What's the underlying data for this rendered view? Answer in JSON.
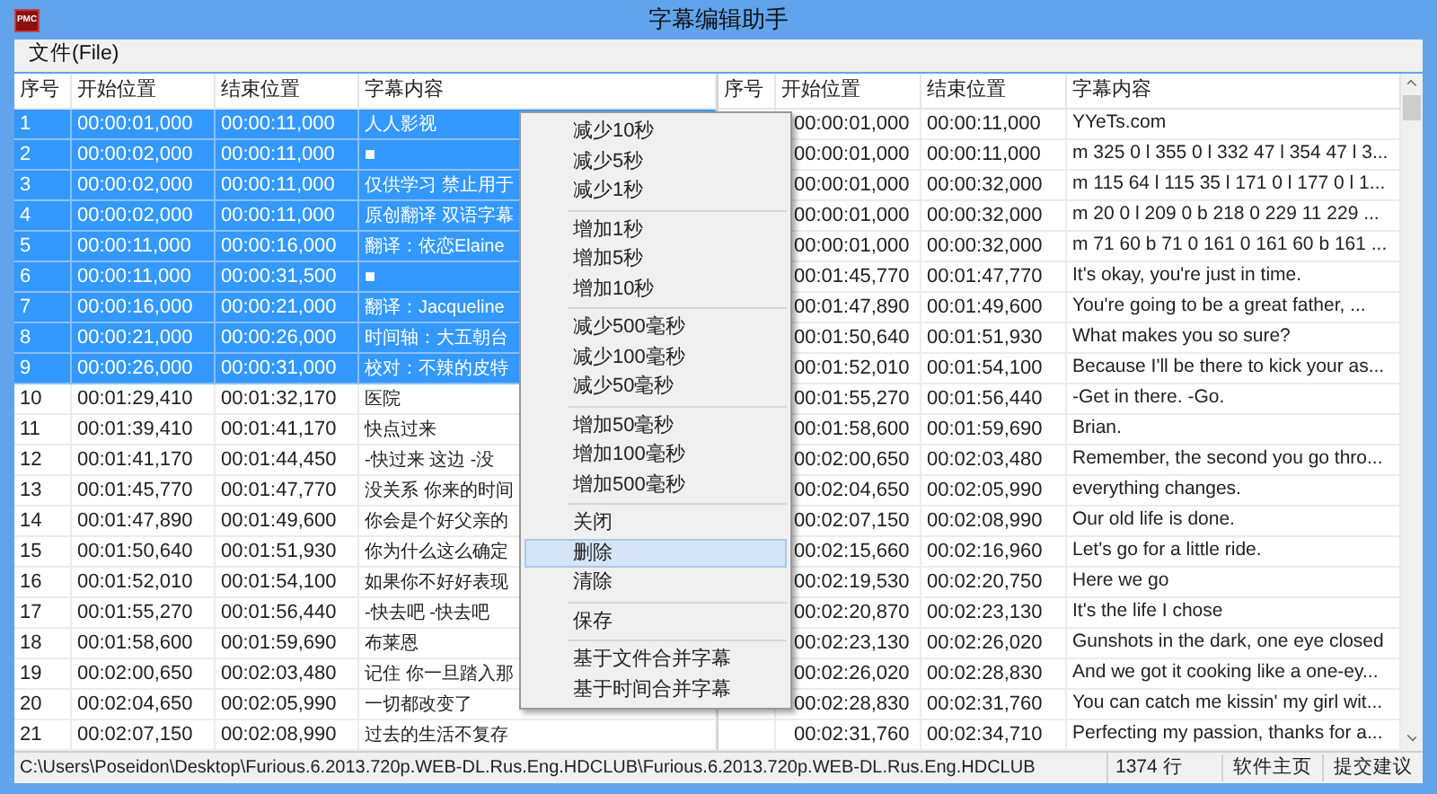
{
  "window": {
    "title": "字幕编辑助手",
    "icon_text": "PMC"
  },
  "menu_bar": [
    "文件(File)"
  ],
  "left_table": {
    "columns": [
      "序号",
      "开始位置",
      "结束位置",
      "字幕内容"
    ],
    "rows": [
      {
        "cells": [
          "1",
          "00:00:01,000",
          "00:00:11,000",
          "人人影视"
        ],
        "selected": true
      },
      {
        "cells": [
          "2",
          "00:00:02,000",
          "00:00:11,000",
          "■"
        ],
        "selected": true
      },
      {
        "cells": [
          "3",
          "00:00:02,000",
          "00:00:11,000",
          "仅供学习 禁止用于"
        ],
        "selected": true
      },
      {
        "cells": [
          "4",
          "00:00:02,000",
          "00:00:11,000",
          "原创翻译 双语字幕"
        ],
        "selected": true
      },
      {
        "cells": [
          "5",
          "00:00:11,000",
          "00:00:16,000",
          "翻译：依恋Elaine"
        ],
        "selected": true
      },
      {
        "cells": [
          "6",
          "00:00:11,000",
          "00:00:31,500",
          "■"
        ],
        "selected": true
      },
      {
        "cells": [
          "7",
          "00:00:16,000",
          "00:00:21,000",
          "翻译：Jacqueline"
        ],
        "selected": true
      },
      {
        "cells": [
          "8",
          "00:00:21,000",
          "00:00:26,000",
          "时间轴：大五朝台"
        ],
        "selected": true
      },
      {
        "cells": [
          "9",
          "00:00:26,000",
          "00:00:31,000",
          "校对：不辣的皮特"
        ],
        "selected": true
      },
      {
        "cells": [
          "10",
          "00:01:29,410",
          "00:01:32,170",
          "医院"
        ],
        "selected": false
      },
      {
        "cells": [
          "11",
          "00:01:39,410",
          "00:01:41,170",
          "快点过来"
        ],
        "selected": false
      },
      {
        "cells": [
          "12",
          "00:01:41,170",
          "00:01:44,450",
          "-快过来  这边  -没"
        ],
        "selected": false
      },
      {
        "cells": [
          "13",
          "00:01:45,770",
          "00:01:47,770",
          "没关系  你来的时间"
        ],
        "selected": false
      },
      {
        "cells": [
          "14",
          "00:01:47,890",
          "00:01:49,600",
          "你会是个好父亲的"
        ],
        "selected": false
      },
      {
        "cells": [
          "15",
          "00:01:50,640",
          "00:01:51,930",
          "你为什么这么确定"
        ],
        "selected": false
      },
      {
        "cells": [
          "16",
          "00:01:52,010",
          "00:01:54,100",
          "如果你不好好表现"
        ],
        "selected": false
      },
      {
        "cells": [
          "17",
          "00:01:55,270",
          "00:01:56,440",
          "-快去吧  -快去吧"
        ],
        "selected": false
      },
      {
        "cells": [
          "18",
          "00:01:58,600",
          "00:01:59,690",
          "布莱恩"
        ],
        "selected": false
      },
      {
        "cells": [
          "19",
          "00:02:00,650",
          "00:02:03,480",
          "记住  你一旦踏入那"
        ],
        "selected": false
      },
      {
        "cells": [
          "20",
          "00:02:04,650",
          "00:02:05,990",
          "一切都改变了"
        ],
        "selected": false
      },
      {
        "cells": [
          "21",
          "00:02:07,150",
          "00:02:08,990",
          "过去的生活不复存"
        ],
        "selected": false
      }
    ]
  },
  "right_table": {
    "columns": [
      "序号",
      "开始位置",
      "结束位置",
      "字幕内容"
    ],
    "rows": [
      [
        "",
        "00:00:01,000",
        "00:00:11,000",
        "YYeTs.com"
      ],
      [
        "",
        "00:00:01,000",
        "00:00:11,000",
        "m 325 0 l 355 0 l 332 47 l 354 47 l 3..."
      ],
      [
        "",
        "00:00:01,000",
        "00:00:32,000",
        "m 115 64 l 115 35 l 171 0 l 177 0 l 1..."
      ],
      [
        "",
        "00:00:01,000",
        "00:00:32,000",
        "m 20 0 l 209 0 b 218 0 229 11 229 ..."
      ],
      [
        "",
        "00:00:01,000",
        "00:00:32,000",
        "m 71 60 b 71 0 161 0 161 60 b 161 ..."
      ],
      [
        "",
        "00:01:45,770",
        "00:01:47,770",
        "It's okay, you're just in time."
      ],
      [
        "",
        "00:01:47,890",
        "00:01:49,600",
        "You're going to be a great father, ..."
      ],
      [
        "",
        "00:01:50,640",
        "00:01:51,930",
        "What makes you so sure?"
      ],
      [
        "",
        "00:01:52,010",
        "00:01:54,100",
        "Because I'll be there to kick your as..."
      ],
      [
        "",
        "00:01:55,270",
        "00:01:56,440",
        "-Get in there. -Go."
      ],
      [
        "",
        "00:01:58,600",
        "00:01:59,690",
        "Brian."
      ],
      [
        "",
        "00:02:00,650",
        "00:02:03,480",
        "Remember, the second you go thro..."
      ],
      [
        "",
        "00:02:04,650",
        "00:02:05,990",
        "everything changes."
      ],
      [
        "",
        "00:02:07,150",
        "00:02:08,990",
        "Our old life is done."
      ],
      [
        "",
        "00:02:15,660",
        "00:02:16,960",
        "Let's go for a little ride."
      ],
      [
        "",
        "00:02:19,530",
        "00:02:20,750",
        "Here we go"
      ],
      [
        "",
        "00:02:20,870",
        "00:02:23,130",
        "It's the life I chose"
      ],
      [
        "",
        "00:02:23,130",
        "00:02:26,020",
        "Gunshots in the dark, one eye closed"
      ],
      [
        "",
        "00:02:26,020",
        "00:02:28,830",
        "And we got it cooking like a one-ey..."
      ],
      [
        "",
        "00:02:28,830",
        "00:02:31,760",
        "You can catch me kissin' my girl wit..."
      ],
      [
        "",
        "00:02:31,760",
        "00:02:34,710",
        "Perfecting my passion, thanks for a..."
      ]
    ]
  },
  "context_menu": {
    "groups": [
      [
        {
          "label": "减少10秒",
          "selected": false
        },
        {
          "label": "减少5秒",
          "selected": false
        },
        {
          "label": "减少1秒",
          "selected": false
        }
      ],
      [
        {
          "label": "增加1秒",
          "selected": false
        },
        {
          "label": "增加5秒",
          "selected": false
        },
        {
          "label": "增加10秒",
          "selected": false
        }
      ],
      [
        {
          "label": "减少500毫秒",
          "selected": false
        },
        {
          "label": "减少100毫秒",
          "selected": false
        },
        {
          "label": "减少50毫秒",
          "selected": false
        }
      ],
      [
        {
          "label": "增加50毫秒",
          "selected": false
        },
        {
          "label": "增加100毫秒",
          "selected": false
        },
        {
          "label": "增加500毫秒",
          "selected": false
        }
      ],
      [
        {
          "label": "关闭",
          "selected": false
        },
        {
          "label": "删除",
          "selected": true
        },
        {
          "label": "清除",
          "selected": false
        }
      ],
      [
        {
          "label": "保存",
          "selected": false
        }
      ],
      [
        {
          "label": "基于文件合并字幕",
          "selected": false
        },
        {
          "label": "基于时间合并字幕",
          "selected": false
        }
      ]
    ]
  },
  "status_bar": {
    "path": "C:\\Users\\Poseidon\\Desktop\\Furious.6.2013.720p.WEB-DL.Rus.Eng.HDCLUB\\Furious.6.2013.720p.WEB-DL.Rus.Eng.HDCLUB",
    "line_count": "1374 行",
    "links": [
      "软件主页",
      "提交建议"
    ]
  }
}
